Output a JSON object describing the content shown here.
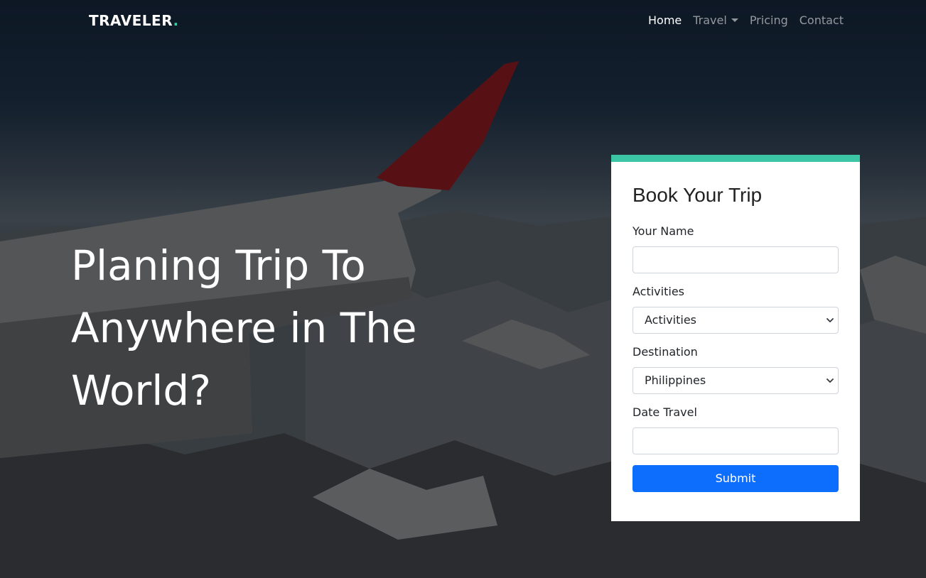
{
  "navbar": {
    "brand": "TRAVELER",
    "brand_dot": ".",
    "links": [
      {
        "label": "Home",
        "active": true
      },
      {
        "label": "Travel",
        "dropdown": true
      },
      {
        "label": "Pricing"
      },
      {
        "label": "Contact"
      }
    ]
  },
  "hero": {
    "headline": "Planing Trip To Anywhere in The World?"
  },
  "booking": {
    "title": "Book Your Trip",
    "fields": {
      "name": {
        "label": "Your Name",
        "value": ""
      },
      "activities": {
        "label": "Activities",
        "selected": "Activities"
      },
      "destination": {
        "label": "Destination",
        "selected": "Philippines"
      },
      "date": {
        "label": "Date Travel",
        "value": ""
      }
    },
    "submit_label": "Submit"
  },
  "colors": {
    "accent": "#3cc5a5",
    "primary_button": "#0d6efd",
    "card_background": "#ffffff"
  },
  "icons": {
    "nav_dropdown": "caret-down-icon",
    "select_arrow": "chevron-down-icon"
  }
}
